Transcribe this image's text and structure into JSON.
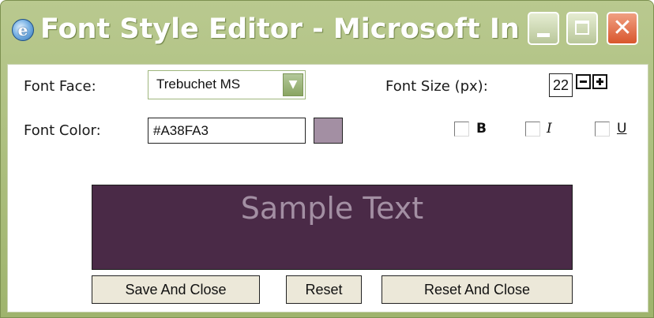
{
  "window": {
    "title": "Font Style Editor - Microsoft In..."
  },
  "title_buttons": {
    "minimize_icon": "minimize-icon",
    "maximize_icon": "maximize-icon",
    "close_glyph": "✕"
  },
  "font_face": {
    "label": "Font Face:",
    "value": "Trebuchet MS"
  },
  "font_size": {
    "label": "Font Size (px):",
    "value": "22"
  },
  "font_color": {
    "label": "Font Color:",
    "value": "#A38FA3",
    "swatch": "#A38FA3"
  },
  "style_options": {
    "bold": {
      "label": "B",
      "checked": false
    },
    "italic": {
      "label": "I",
      "checked": false
    },
    "underline": {
      "label": "U",
      "checked": false
    }
  },
  "preview": {
    "text": "Sample Text",
    "background": "#4A2A47",
    "text_color": "#A38FA3"
  },
  "buttons": {
    "save_close": "Save And Close",
    "reset": "Reset",
    "reset_close": "Reset And Close"
  },
  "colors": {
    "titlebar": "#A9BD7E",
    "close_button": "#D9562D",
    "button_face": "#ECE8D9"
  }
}
